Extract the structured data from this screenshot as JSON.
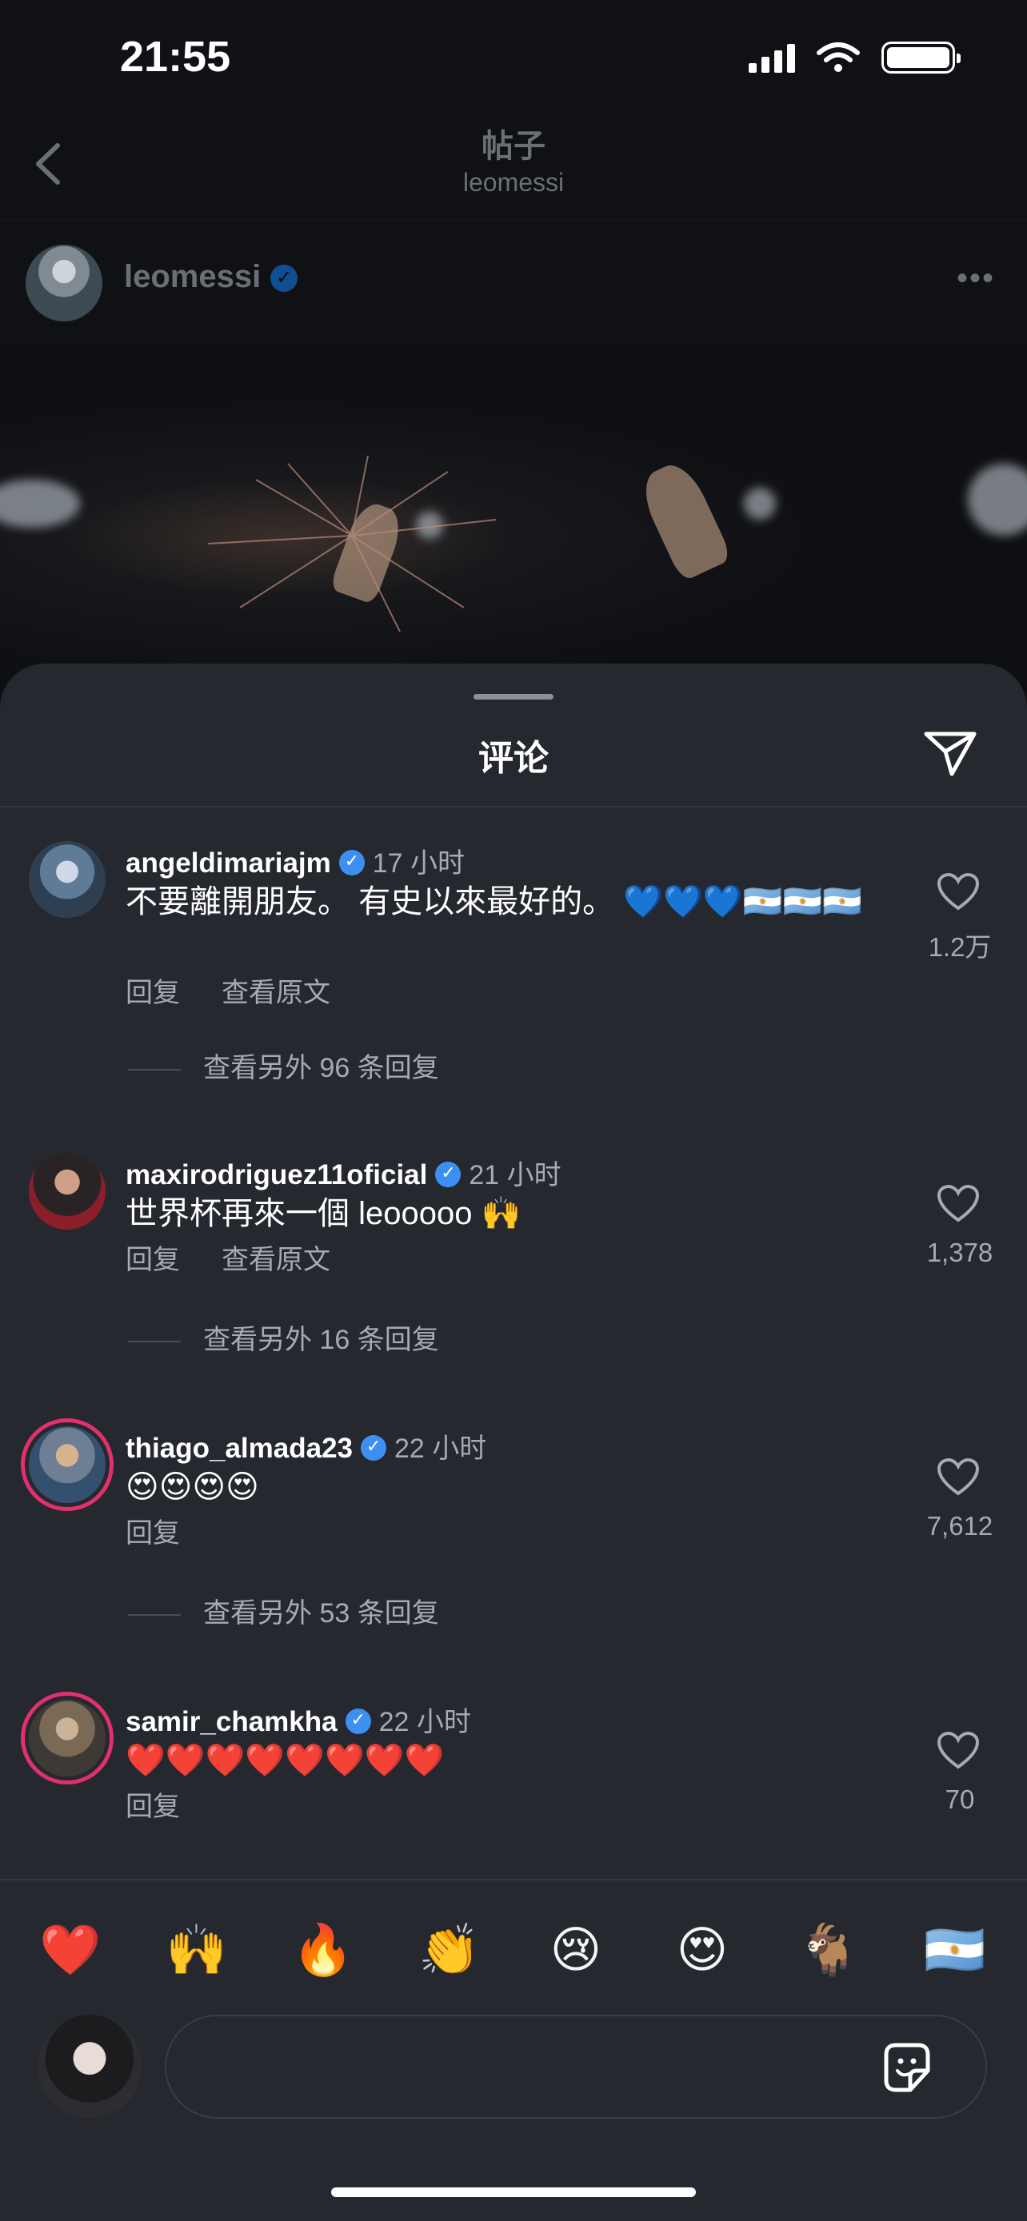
{
  "status": {
    "time": "21:55"
  },
  "header": {
    "title": "帖子",
    "subtitle": "leomessi"
  },
  "post": {
    "username": "leomessi"
  },
  "sheet": {
    "title": "评论"
  },
  "comments": [
    {
      "user": "angeldimariajm",
      "time": "17 小时",
      "text": "不要離開朋友。 有史以來最好的。 💙💙💙🇦🇷🇦🇷🇦🇷",
      "likes": "1.2万",
      "actions": [
        "回复",
        "查看原文"
      ],
      "more_replies": "查看另外 96 条回复"
    },
    {
      "user": "maxirodriguez11oficial",
      "time": "21 小时",
      "text": "世界杯再來一個 leooooo 🙌",
      "likes": "1,378",
      "actions": [
        "回复",
        "查看原文"
      ],
      "more_replies": "查看另外 16 条回复"
    },
    {
      "user": "thiago_almada23",
      "time": "22 小时",
      "text": "😍😍😍😍",
      "likes": "7,612",
      "actions": [
        "回复"
      ],
      "more_replies": "查看另外 53 条回复"
    },
    {
      "user": "samir_chamkha",
      "time": "22 小时",
      "text": "❤️❤️❤️❤️❤️❤️❤️❤️",
      "likes": "70",
      "actions": [
        "回复"
      ]
    }
  ],
  "emoji_bar": [
    "❤️",
    "🙌",
    "🔥",
    "👏",
    "😢",
    "😍",
    "🐐",
    "🇦🇷"
  ],
  "input": {
    "placeholder": ""
  },
  "colors": {
    "background": "#0f1115",
    "sheet": "#25282e",
    "verified": "#3d8ff2",
    "secondary_text": "#a7aab0"
  }
}
